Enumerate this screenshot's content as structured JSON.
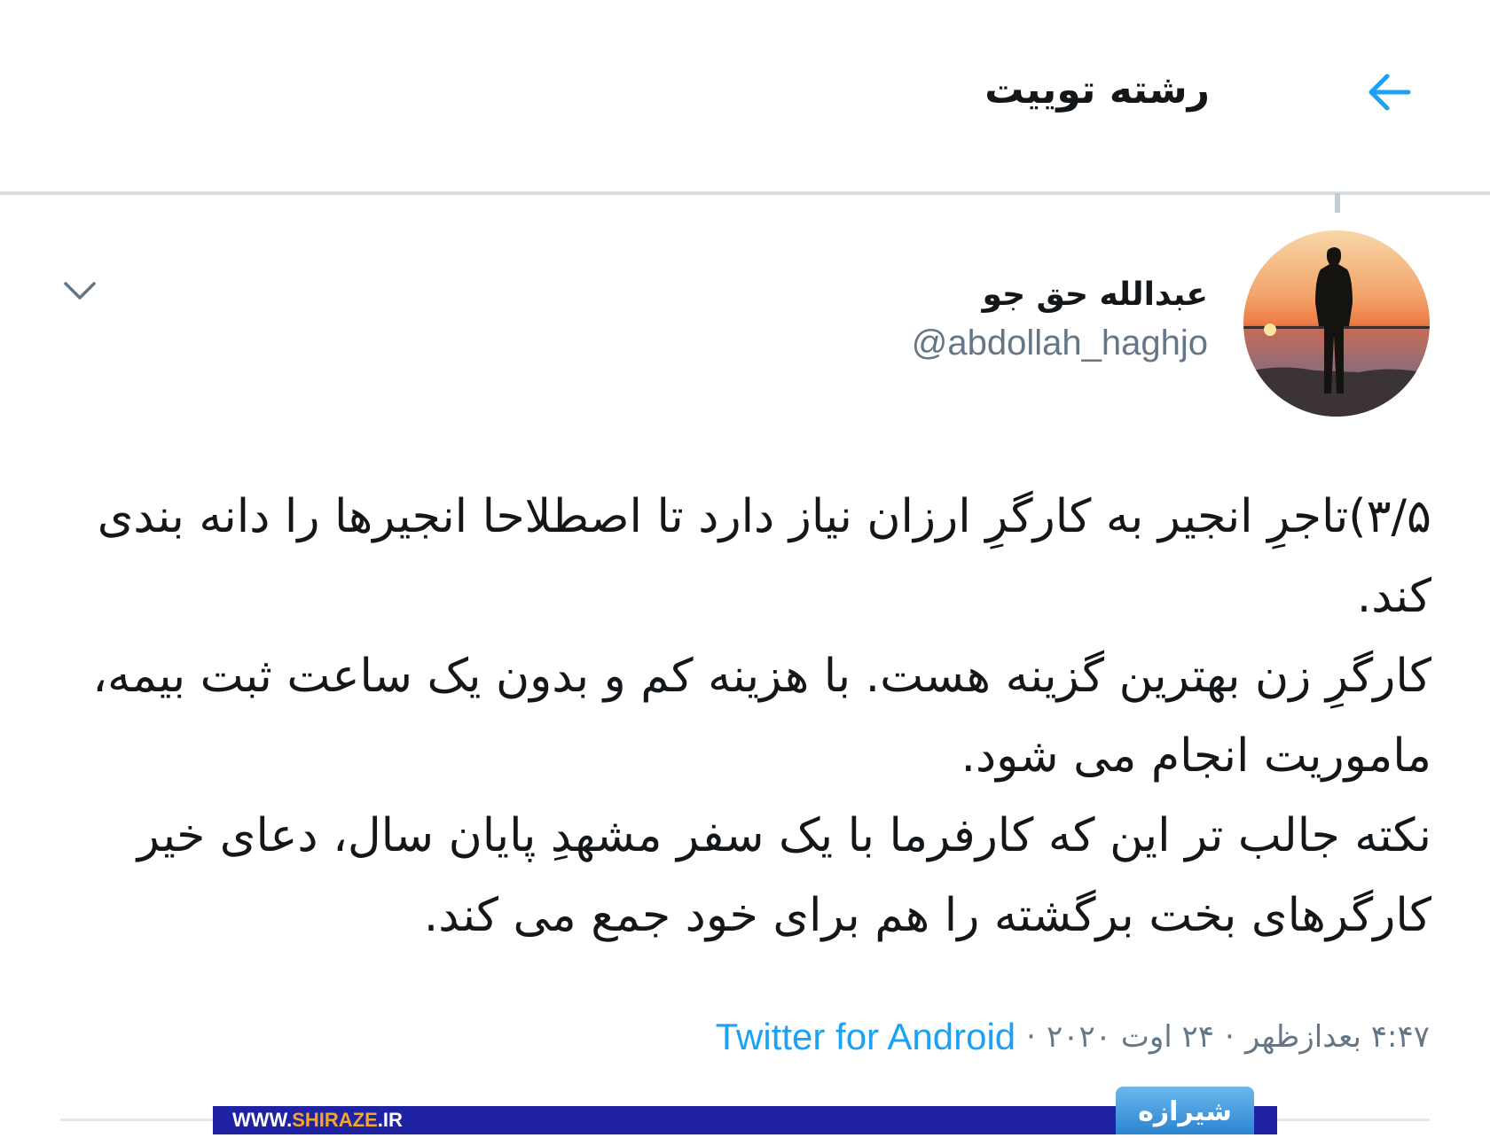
{
  "header": {
    "title": "رشته توییت",
    "back_icon": "arrow-left-icon"
  },
  "tweet": {
    "author": {
      "display_name": "عبدالله حق جو",
      "handle": "@abdollah_haghjo"
    },
    "more_icon": "chevron-down-icon",
    "paragraphs": [
      "۳/۵)تاجرِ انجیر به کارگرِ ارزان نیاز دارد تا اصطلاحا انجیرها را دانه بندی کند.",
      "کارگرِ زن بهترین گزینه هست. با هزینه کم و بدون یک ساعت ثبت بیمه، ماموریت انجام می شود.",
      "نکته جالب تر این که کارفرما با یک سفر مشهدِ پایان سال، دعای خیر کارگرهای بخت برگشته را هم برای خود جمع می کند."
    ],
    "meta": {
      "time": "۴:۴۷ بعدازظهر",
      "separator": "·",
      "date": "۲۴ اوت ۲۰۲۰",
      "source": "Twitter for Android"
    }
  },
  "watermark": {
    "url_prefix": "WWW.",
    "url_highlight": "SHIRAZE",
    "url_suffix": ".IR",
    "logo_text": "شیرازه"
  },
  "colors": {
    "accent": "#1da1f2",
    "secondary_text": "#657786",
    "divider": "#d7dde2",
    "watermark_bar": "#1f23a3"
  }
}
